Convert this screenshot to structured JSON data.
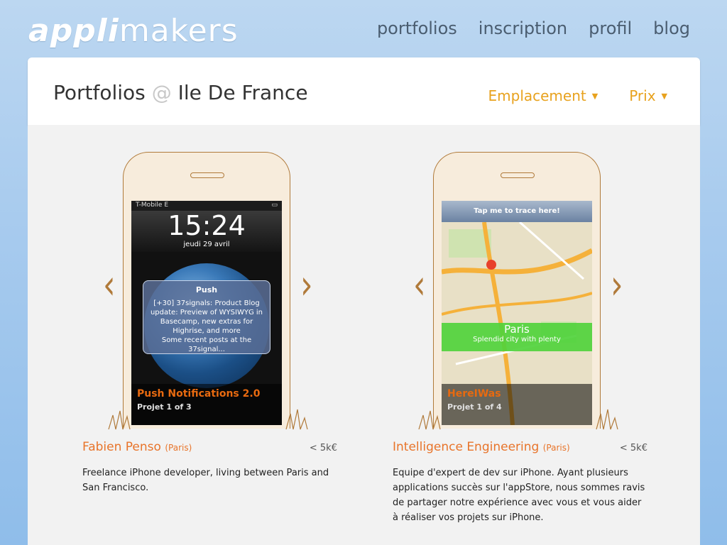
{
  "header": {
    "logo_bold": "appli",
    "logo_light": "makers",
    "nav": [
      "portfolios",
      "inscription",
      "profil",
      "blog"
    ]
  },
  "titlebar": {
    "title_prefix": "Portfolios",
    "title_at": "@",
    "title_place": "Ile De France",
    "filters": [
      "Emplacement",
      "Prix"
    ]
  },
  "colors": {
    "accent": "#e8a21e",
    "name": "#e8742a",
    "phone_outline": "#b07a3a"
  },
  "portfolios": [
    {
      "screen": {
        "carrier": "T-Mobile",
        "network": "E",
        "time": "15:24",
        "date": "jeudi 29 avril",
        "push_title": "Push",
        "push_body": "[+30] 37signals: Product Blog update: Preview of WYSIWYG in Basecamp, new extras for Highrise, and more",
        "push_more": "Some recent posts at the 37signal..."
      },
      "project_name": "Push Notifications 2.0",
      "project_count": "Projet 1 of 3",
      "name": "Fabien Penso",
      "city": "(Paris)",
      "price": "< 5k€",
      "description": "Freelance iPhone developer, living between Paris and San Francisco."
    },
    {
      "screen": {
        "tap_label": "Tap me to trace here!",
        "map_city": "Paris",
        "map_desc": "Splendid city with plenty"
      },
      "project_name": "HereIWas",
      "project_count": "Projet 1 of 4",
      "name": "Intelligence Engineering",
      "city": "(Paris)",
      "price": "< 5k€",
      "description": "Equipe d'expert de dev sur iPhone. Ayant plusieurs applications succès sur l'appStore, nous sommes ravis de partager notre expérience avec vous et vous aider à réaliser vos projets sur iPhone."
    }
  ]
}
